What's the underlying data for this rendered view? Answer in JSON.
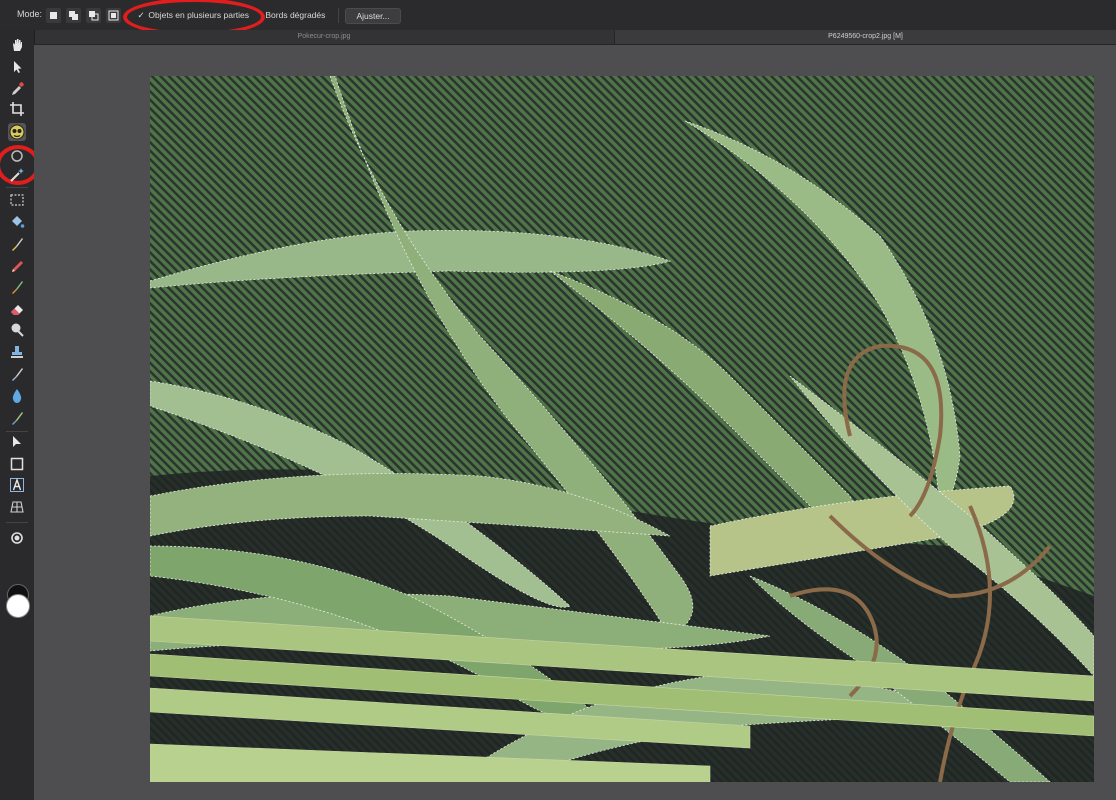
{
  "context_toolbar": {
    "mode_label": "Mode:",
    "options": [
      {
        "label": "Objets en plusieurs parties",
        "checked": true
      },
      {
        "label": "Bords dégradés",
        "checked": false
      }
    ],
    "adjust_label": "Ajuster..."
  },
  "tabs": [
    {
      "label": "Pokecur-crop.jpg",
      "active": false
    },
    {
      "label": "P6249560-crop2.jpg [M]",
      "active": true
    }
  ],
  "tools": [
    "hand-icon",
    "move-icon",
    "color-picker-icon",
    "crop-icon",
    "selection-brush-icon",
    "refine-brush-icon",
    "magic-wand-icon",
    "marquee-icon",
    "fill-icon",
    "paint-brush-icon",
    "pencil-icon",
    "mixer-brush-icon",
    "eraser-icon",
    "dodge-icon",
    "clone-stamp-icon",
    "healing-brush-icon",
    "blur-icon",
    "smudge-icon",
    "node-pointer-icon",
    "shape-icon",
    "text-icon",
    "mesh-warp-icon",
    "zoom-icon"
  ],
  "colors": {
    "annotation": "#e01e1e",
    "selection_overlay": "#4f7448",
    "stripe_dark": "#2c3430",
    "leaf_green": "#8fb07a",
    "stem_green": "#a6c47d"
  }
}
